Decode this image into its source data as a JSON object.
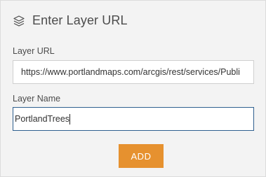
{
  "header": {
    "icon": "layers-icon",
    "title": "Enter Layer URL"
  },
  "layer_url": {
    "label": "Layer URL",
    "value": "https://www.portlandmaps.com/arcgis/rest/services/Publi"
  },
  "layer_name": {
    "label": "Layer Name",
    "value": "PortlandTrees"
  },
  "add_button": {
    "label": "ADD",
    "color": "#e6912f"
  }
}
